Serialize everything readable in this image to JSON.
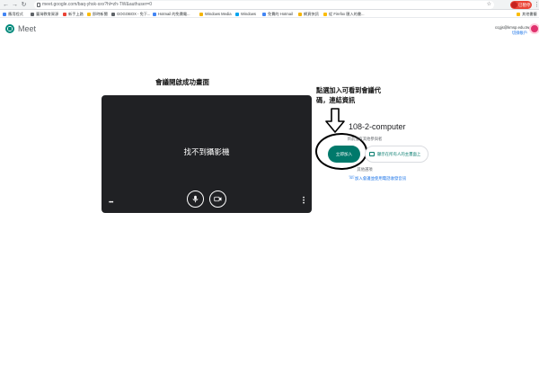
{
  "browser": {
    "url": "meet.google.com/baq-yhsk-sxv?hl=zh-TW&authuser=0",
    "profile_label": "已暫停",
    "bookmarks": [
      {
        "label": "應用程式",
        "color": "#4285f4"
      },
      {
        "label": "臺灣教育資源",
        "color": "#5f6368"
      },
      {
        "label": "新手上路",
        "color": "#ea4335"
      },
      {
        "label": "即時新聞",
        "color": "#fbbc04"
      },
      {
        "label": "GOGOBOX - 免下...",
        "color": "#5f6368"
      },
      {
        "label": "Hotmail 的免費電...",
        "color": "#4285f4"
      },
      {
        "label": "Windows Media",
        "color": "#f4b400"
      },
      {
        "label": "Windows",
        "color": "#00a4ef"
      },
      {
        "label": "免費的 Hotmail",
        "color": "#4285f4"
      },
      {
        "label": "網頁快訊",
        "color": "#f4b400"
      },
      {
        "label": "從 Firefox 匯入的書...",
        "color": "#fbbc04"
      },
      {
        "label": "其他書籤",
        "color": "#fbbc04"
      }
    ]
  },
  "header": {
    "app_name": "Meet",
    "account_line1": "ccgjs@kmsp.edu.tw",
    "account_line2": "切換帳戶"
  },
  "annotations": {
    "title": "會議開啟成功畫面",
    "hint": "點選加入可看到會議代碼，連結資訊"
  },
  "preview": {
    "message": "找不到攝影機"
  },
  "join_panel": {
    "meeting_name": "108-2-computer",
    "no_one_text": "目前沒有其他參與者",
    "join_label": "立即加入",
    "present_label": "顯示在所有人的主畫面上",
    "other_options": "其他選項",
    "phone_label": "加入會議並使用電話收發音訊"
  },
  "icons": {
    "mic": "microphone-icon",
    "camera": "camera-icon",
    "present": "present-screen-icon",
    "phone": "phone-icon"
  },
  "colors": {
    "accent": "#00796b",
    "preview_bg": "#202124",
    "link": "#1a73e8"
  }
}
